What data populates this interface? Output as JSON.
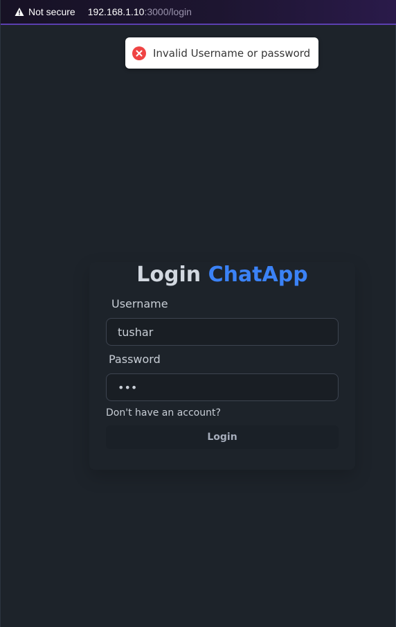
{
  "browser": {
    "security_label": "Not secure",
    "url_host": "192.168.1.10",
    "url_rest": ":3000/login"
  },
  "toast": {
    "message": "Invalid Username or password",
    "icon": "error-x-icon",
    "color": "#ef4444"
  },
  "form": {
    "title_prefix": "Login",
    "title_brand": "ChatApp",
    "brand_color": "#3b82f6",
    "username_label": "Username",
    "username_value": "tushar",
    "password_label": "Password",
    "password_value": "abc",
    "signup_link": "Don't have an account?",
    "login_button": "Login"
  }
}
